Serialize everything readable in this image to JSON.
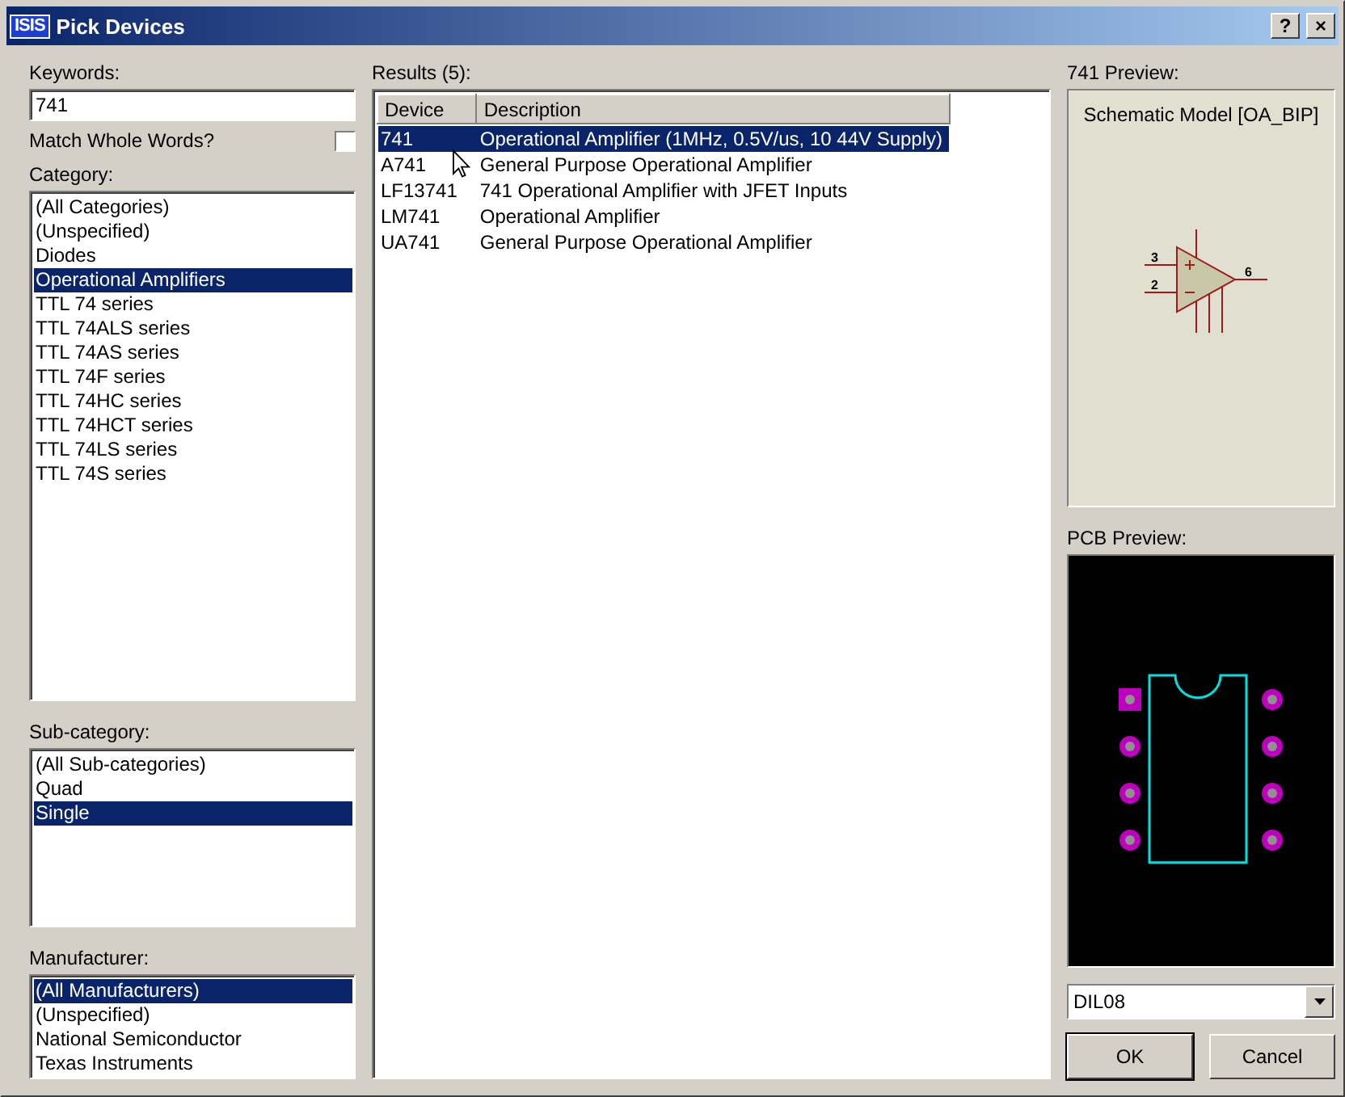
{
  "window": {
    "logo": "ISIS",
    "title": "Pick Devices",
    "help": "?",
    "close": "×"
  },
  "keywords": {
    "label": "Keywords:",
    "value": "741"
  },
  "match_whole_words": {
    "label": "Match Whole Words?",
    "checked": false
  },
  "category": {
    "label": "Category:",
    "items": [
      {
        "label": "(All Categories)",
        "selected": false
      },
      {
        "label": "(Unspecified)",
        "selected": false
      },
      {
        "label": "Diodes",
        "selected": false
      },
      {
        "label": "Operational Amplifiers",
        "selected": true
      },
      {
        "label": "TTL 74 series",
        "selected": false
      },
      {
        "label": "TTL 74ALS series",
        "selected": false
      },
      {
        "label": "TTL 74AS series",
        "selected": false
      },
      {
        "label": "TTL 74F series",
        "selected": false
      },
      {
        "label": "TTL 74HC series",
        "selected": false
      },
      {
        "label": "TTL 74HCT series",
        "selected": false
      },
      {
        "label": "TTL 74LS series",
        "selected": false
      },
      {
        "label": "TTL 74S series",
        "selected": false
      }
    ]
  },
  "sub_category": {
    "label": "Sub-category:",
    "items": [
      {
        "label": "(All Sub-categories)",
        "selected": false
      },
      {
        "label": "Quad",
        "selected": false
      },
      {
        "label": "Single",
        "selected": true
      }
    ]
  },
  "manufacturer": {
    "label": "Manufacturer:",
    "items": [
      {
        "label": "(All Manufacturers)",
        "selected": true
      },
      {
        "label": "(Unspecified)",
        "selected": false
      },
      {
        "label": "National Semiconductor",
        "selected": false
      },
      {
        "label": "Texas Instruments",
        "selected": false
      }
    ]
  },
  "results": {
    "label": "Results (5):",
    "columns": [
      "Device",
      "Description"
    ],
    "rows": [
      {
        "device": "741",
        "description": "Operational Amplifier (1MHz, 0.5V/us, 10 44V Supply)",
        "selected": true
      },
      {
        "device": "A741",
        "description": "General Purpose Operational Amplifier",
        "selected": false
      },
      {
        "device": "LF13741",
        "description": "741 Operational Amplifier with JFET Inputs",
        "selected": false
      },
      {
        "device": "LM741",
        "description": "Operational Amplifier",
        "selected": false
      },
      {
        "device": "UA741",
        "description": "General Purpose Operational Amplifier",
        "selected": false
      }
    ]
  },
  "schematic_preview": {
    "label": "741 Preview:",
    "model": "Schematic Model [OA_BIP]",
    "pins": [
      "3",
      "2",
      "6"
    ]
  },
  "pcb_preview": {
    "label": "PCB Preview:",
    "package": "DIL08"
  },
  "buttons": [
    {
      "label": "OK",
      "default": true
    },
    {
      "label": "Cancel",
      "default": false
    }
  ]
}
